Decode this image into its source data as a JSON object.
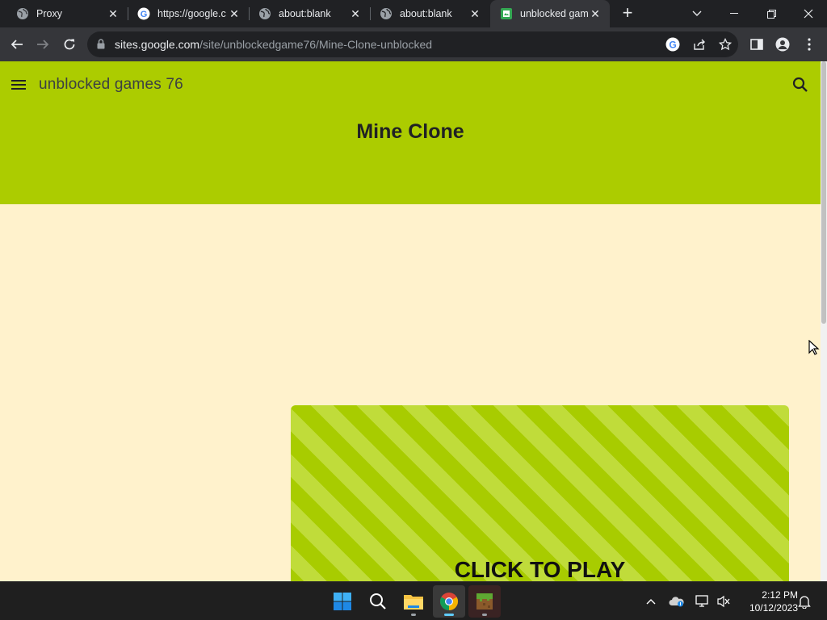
{
  "browser": {
    "tabs": [
      {
        "title": "Proxy",
        "icon": "globe-icon"
      },
      {
        "title": "https://google.c",
        "icon": "google-icon"
      },
      {
        "title": "about:blank",
        "icon": "globe-icon"
      },
      {
        "title": "about:blank",
        "icon": "globe-icon"
      },
      {
        "title": "unblocked gam",
        "icon": "google-sites-icon",
        "active": true
      }
    ],
    "new_tab_symbol": "+",
    "url_host": "sites.google.com",
    "url_path": "/site/unblockedgame76/Mine-Clone-unblocked"
  },
  "site": {
    "name": "unblocked games 76",
    "page_title": "Mine Clone",
    "play_label": "CLICK TO PLAY",
    "header_color": "#accc00",
    "page_bg": "#fff2cc"
  },
  "taskbar": {
    "time": "2:12 PM",
    "date": "10/12/2023",
    "apps": [
      "windows-start-icon",
      "search-icon",
      "file-explorer-icon",
      "chrome-icon",
      "minecraft-icon"
    ]
  }
}
